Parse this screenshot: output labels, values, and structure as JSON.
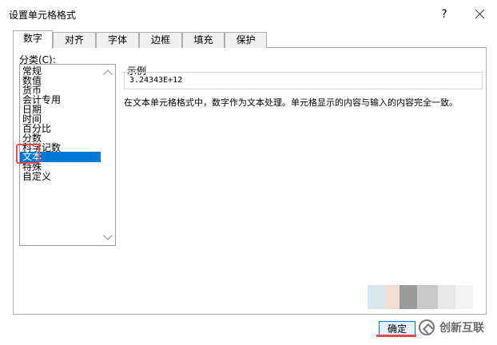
{
  "window": {
    "title": "设置单元格格式",
    "help_label": "?"
  },
  "tabs": [
    {
      "label": "数字",
      "active": true
    },
    {
      "label": "对齐",
      "active": false
    },
    {
      "label": "字体",
      "active": false
    },
    {
      "label": "边框",
      "active": false
    },
    {
      "label": "填充",
      "active": false
    },
    {
      "label": "保护",
      "active": false
    }
  ],
  "category": {
    "label": "分类(C):",
    "selected": "文本",
    "items": [
      "常规",
      "数值",
      "货币",
      "会计专用",
      "日期",
      "时间",
      "百分比",
      "分数",
      "科学记数",
      "文本",
      "特殊",
      "自定义"
    ]
  },
  "sample": {
    "label": "示例",
    "value": "3.24343E+12"
  },
  "description": "在文本单元格格式中，数字作为文本处理。单元格显示的内容与输入的内容完全一致。",
  "buttons": {
    "ok_label": "确定"
  },
  "watermark": {
    "text": "创新互联"
  },
  "colors": {
    "selection": "#0078d7",
    "highlight": "#e34b4b"
  }
}
